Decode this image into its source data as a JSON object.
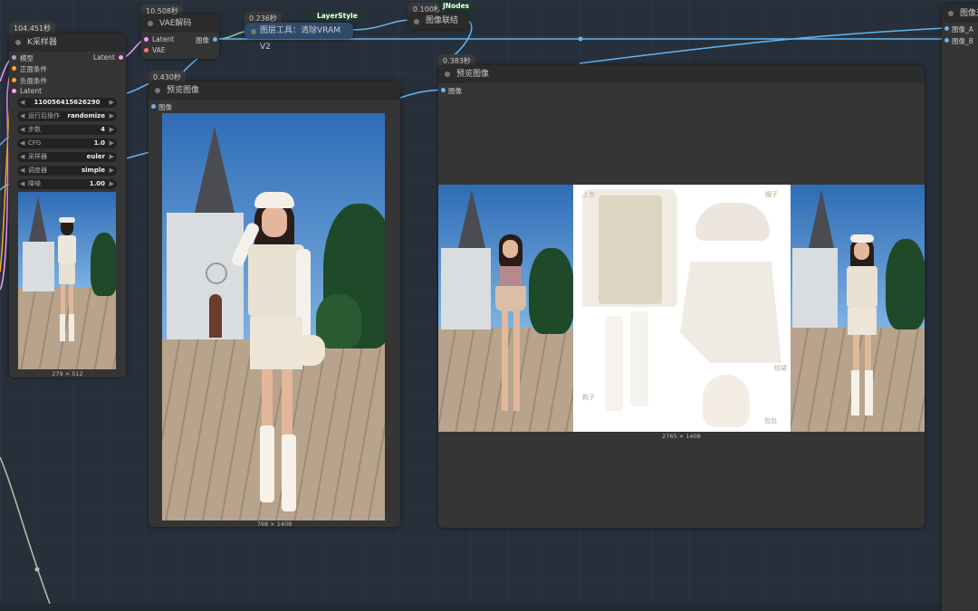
{
  "nodes": {
    "ksampler": {
      "timing": "104.451秒",
      "title": "K采样器",
      "inputs": [
        "模型",
        "正面条件",
        "负面条件",
        "Latent"
      ],
      "output": "Latent",
      "widgets": [
        {
          "label": "",
          "value": "110056415626290"
        },
        {
          "label": "运行后操作",
          "value": "randomize"
        },
        {
          "label": "步数",
          "value": "4"
        },
        {
          "label": "CFG",
          "value": "1.0"
        },
        {
          "label": "采样器",
          "value": "euler"
        },
        {
          "label": "调度器",
          "value": "simple"
        },
        {
          "label": "降噪",
          "value": "1.00"
        }
      ],
      "preview_size": "279 × 512"
    },
    "vae_decode": {
      "timing": "10.508秒",
      "title": "VAE解码",
      "inputs": [
        "Latent",
        "VAE"
      ],
      "output": "图像"
    },
    "layer_tool": {
      "timing": "0.236秒",
      "badge": "LayerStyle",
      "title": "图层工具：清除VRAM V2"
    },
    "image_concat": {
      "timing": "0.100秒",
      "badge": "JNodes",
      "title": "图像联结"
    },
    "image_compare": {
      "title": "图像对",
      "inputs": [
        "图像_A",
        "图像_B"
      ]
    },
    "preview1": {
      "timing": "0.430秒",
      "title": "预览图像",
      "input": "图像",
      "size": "768 × 1408"
    },
    "preview2": {
      "timing": "0.383秒",
      "title": "预览图像",
      "input": "图像",
      "size": "2765 × 1408"
    }
  },
  "outfit_labels": {
    "top": "上衣",
    "hat": "帽子",
    "skirt": "短裙",
    "boots": "靴子",
    "bag": "包包"
  },
  "colors": {
    "canvas": "#27303a",
    "node_body": "#353535",
    "wire_image": "#64b5f6",
    "wire_latent": "#ff9cf9",
    "wire_vae": "#ff6e6e",
    "wire_cond": "#ffa931"
  }
}
